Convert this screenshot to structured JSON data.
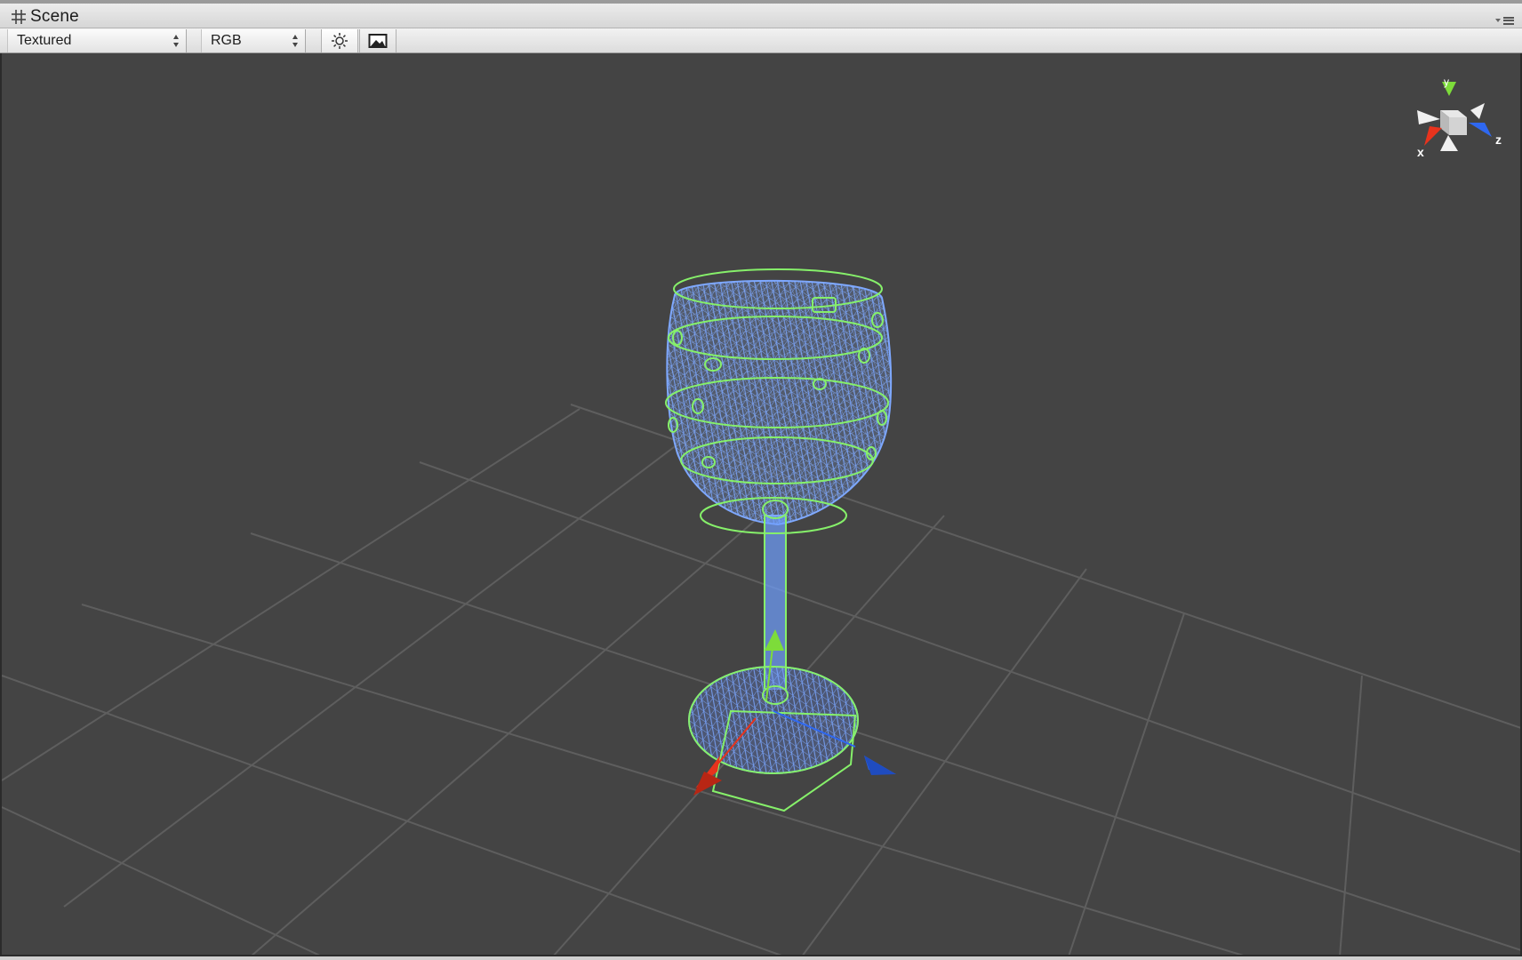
{
  "window": {
    "tab_title": "Scene",
    "tab_icon": "scene-grid-icon",
    "menu_icon": "window-menu-icon"
  },
  "toolbar": {
    "render_mode": {
      "selected": "Textured",
      "icon": "dropdown-arrows-icon"
    },
    "color_mode": {
      "selected": "RGB",
      "icon": "dropdown-arrows-icon"
    },
    "lighting_toggle": {
      "icon": "sun-icon",
      "active": true
    },
    "scene_fx_toggle": {
      "icon": "image-icon",
      "active": false
    }
  },
  "viewport": {
    "background_color": "#444444",
    "grid_color": "#5f5f5f",
    "selected_object": "wine-glass",
    "wireframe_color": "#6f9fff",
    "collider_color": "#86f06a",
    "transform_gizmo": {
      "x_color": "#e8331d",
      "y_color": "#7ddc3a",
      "z_color": "#2f68f0"
    },
    "orientation_gizmo": {
      "labels": {
        "x": "x",
        "y": "y",
        "z": "z"
      }
    }
  }
}
